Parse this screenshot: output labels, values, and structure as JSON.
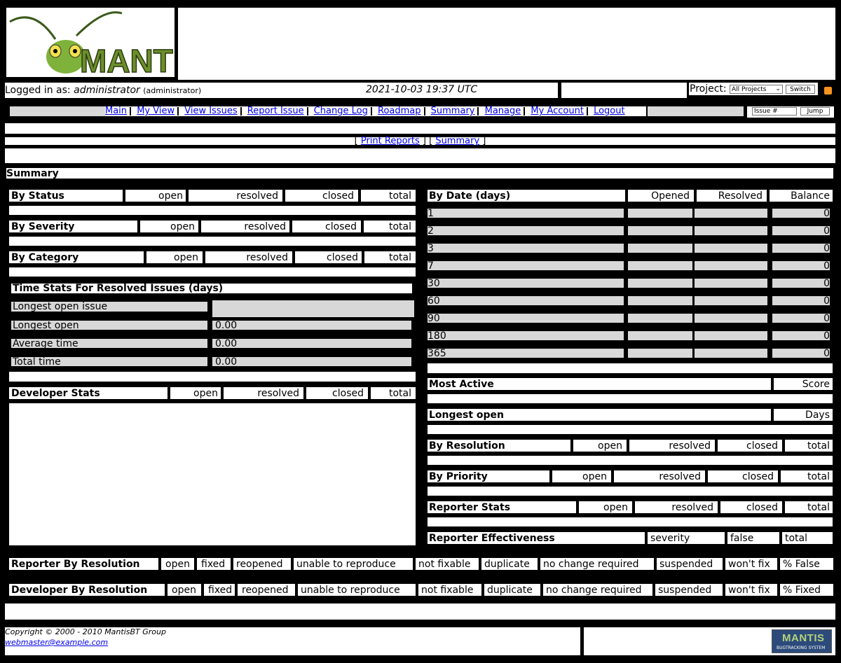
{
  "header": {
    "logo_text": "MANTIS",
    "logged_in_prefix": "Logged in as:",
    "username": "administrator",
    "role": "(administrator)",
    "datetime": "2021-10-03 19:37 UTC",
    "project_label": "Project:",
    "project_selected": "All Projects",
    "switch_label": "Switch"
  },
  "nav": {
    "items": [
      "Main",
      "My View",
      "View Issues",
      "Report Issue",
      "Change Log",
      "Roadmap",
      "Summary",
      "Manage",
      "My Account",
      "Logout"
    ],
    "issue_placeholder": "Issue #",
    "jump_label": "Jump"
  },
  "subnav": {
    "print_reports": "Print Reports",
    "summary": "Summary"
  },
  "summary_title": "Summary",
  "left": {
    "by_status": {
      "title": "By Status",
      "cols": [
        "open",
        "resolved",
        "closed",
        "total"
      ]
    },
    "by_severity": {
      "title": "By Severity",
      "cols": [
        "open",
        "resolved",
        "closed",
        "total"
      ]
    },
    "by_category": {
      "title": "By Category",
      "cols": [
        "open",
        "resolved",
        "closed",
        "total"
      ]
    },
    "time_stats": {
      "title": "Time Stats For Resolved Issues (days)",
      "rows": [
        {
          "label": "Longest open issue",
          "value": ""
        },
        {
          "label": "Longest open",
          "value": "0.00"
        },
        {
          "label": "Average time",
          "value": "0.00"
        },
        {
          "label": "Total time",
          "value": "0.00"
        }
      ]
    },
    "developer_stats": {
      "title": "Developer Stats",
      "cols": [
        "open",
        "resolved",
        "closed",
        "total"
      ]
    }
  },
  "right": {
    "by_date": {
      "title": "By Date (days)",
      "cols": [
        "Opened",
        "Resolved",
        "Balance"
      ],
      "rows": [
        {
          "days": "1",
          "balance": "0"
        },
        {
          "days": "2",
          "balance": "0"
        },
        {
          "days": "3",
          "balance": "0"
        },
        {
          "days": "7",
          "balance": "0"
        },
        {
          "days": "30",
          "balance": "0"
        },
        {
          "days": "60",
          "balance": "0"
        },
        {
          "days": "90",
          "balance": "0"
        },
        {
          "days": "180",
          "balance": "0"
        },
        {
          "days": "365",
          "balance": "0"
        }
      ]
    },
    "most_active": {
      "title": "Most Active",
      "col": "Score"
    },
    "longest_open": {
      "title": "Longest open",
      "col": "Days"
    },
    "by_resolution": {
      "title": "By Resolution",
      "cols": [
        "open",
        "resolved",
        "closed",
        "total"
      ]
    },
    "by_priority": {
      "title": "By Priority",
      "cols": [
        "open",
        "resolved",
        "closed",
        "total"
      ]
    },
    "reporter_stats": {
      "title": "Reporter Stats",
      "cols": [
        "open",
        "resolved",
        "closed",
        "total"
      ]
    },
    "reporter_effectiveness": {
      "title": "Reporter Effectiveness",
      "cols": [
        "severity",
        "false",
        "total"
      ]
    }
  },
  "reporter_by_resolution": {
    "title": "Reporter By Resolution",
    "cols": [
      "open",
      "fixed",
      "reopened",
      "unable to reproduce",
      "not fixable",
      "duplicate",
      "no change required",
      "suspended",
      "won't fix",
      "% False"
    ]
  },
  "developer_by_resolution": {
    "title": "Developer By Resolution",
    "cols": [
      "open",
      "fixed",
      "reopened",
      "unable to reproduce",
      "not fixable",
      "duplicate",
      "no change required",
      "suspended",
      "won't fix",
      "% Fixed"
    ]
  },
  "footer": {
    "copyright": "Copyright © 2000 - 2010 MantisBT Group",
    "email": "webmaster@example.com",
    "badge_text": "MANTIS",
    "badge_sub": "BUGTRACKING SYSTEM"
  }
}
